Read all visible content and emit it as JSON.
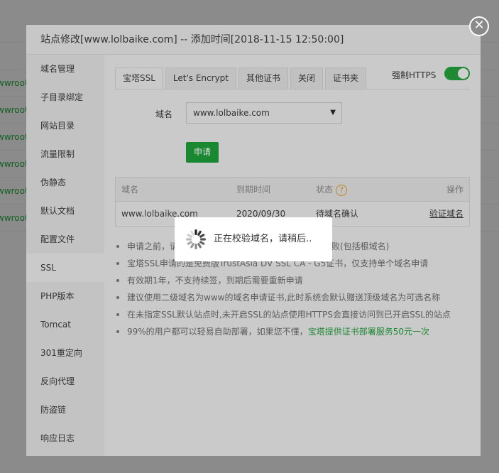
{
  "background": {
    "paths": [
      "wwroot",
      "wwroot",
      "wwroot",
      "wwroot",
      "wwroot",
      "wwroot"
    ]
  },
  "dialog": {
    "title": "站点修改[www.lolbaike.com] -- 添加时间[2018-11-15 12:50:00]",
    "close_icon": "close-icon"
  },
  "sidebar": {
    "items": [
      {
        "label": "域名管理"
      },
      {
        "label": "子目录绑定"
      },
      {
        "label": "网站目录"
      },
      {
        "label": "流量限制"
      },
      {
        "label": "伪静态"
      },
      {
        "label": "默认文档"
      },
      {
        "label": "配置文件"
      },
      {
        "label": "SSL",
        "active": true
      },
      {
        "label": "PHP版本"
      },
      {
        "label": "Tomcat"
      },
      {
        "label": "301重定向"
      },
      {
        "label": "反向代理"
      },
      {
        "label": "防盗链"
      },
      {
        "label": "响应日志"
      }
    ]
  },
  "ssl": {
    "tabs": [
      {
        "label": "宝塔SSL",
        "active": true
      },
      {
        "label": "Let's Encrypt"
      },
      {
        "label": "其他证书"
      },
      {
        "label": "关闭"
      },
      {
        "label": "证书夹"
      }
    ],
    "force_https_label": "强制HTTPS",
    "force_https_on": true,
    "domain_label": "域名",
    "domain_value": "www.lolbaike.com",
    "apply_label": "申请",
    "table": {
      "headers": [
        "域名",
        "到期时间",
        "状态",
        "操作"
      ],
      "help_icon": "?",
      "rows": [
        {
          "domain": "www.lolbaike.com",
          "expire": "2020/09/30",
          "status": "待域名确认",
          "action": "验证域名"
        }
      ]
    },
    "notes": [
      {
        "text": "申请之前，请确保域名已解析，如未解析会导致审核失败(包括根域名)"
      },
      {
        "text": "宝塔SSL申请的是免费版TrustAsia DV SSL CA - G5证书，仅支持单个域名申请"
      },
      {
        "text": "有效期1年，不支持续签，到期后需要重新申请"
      },
      {
        "text": "建议使用二级域名为www的域名申请证书,此时系统会默认赠送顶级域名为可选名称"
      },
      {
        "text": "在未指定SSL默认站点时,未开启SSL的站点使用HTTPS会直接访问到已开启SSL的站点"
      },
      {
        "text": "99%的用户都可以轻易自助部署，如果您不懂，",
        "highlight": "宝塔提供证书部署服务50元一次"
      }
    ]
  },
  "loading": {
    "text": "正在校验域名，请稍后.."
  },
  "colors": {
    "accent_green": "#20a53a",
    "link_blue": "#1d4a78",
    "help_orange": "#c38420"
  }
}
